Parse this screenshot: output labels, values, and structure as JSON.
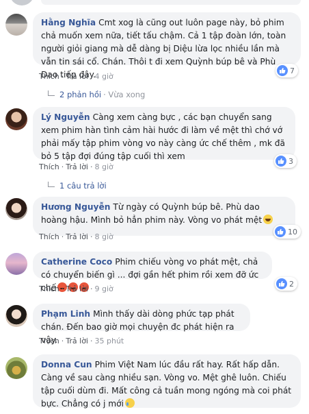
{
  "colors": {
    "author": "#385898",
    "bubble": "#f2f3f5",
    "like": "#5890ff",
    "meta": "#90949c"
  },
  "actions": {
    "like": "Thích",
    "reply": "Trả lời"
  },
  "comments": [
    {
      "author": "Hằng Nghĩa",
      "text": "Cmt xog là cũng out luôn page này, bỏ phim chả muốn xem nữa, tiết tấu chậm. Cả 1 tập đoàn lớn, toàn người giỏi giang mà dễ dàng bị Diệu lừa lọc nhiều lần mà vẫn tin sái cổ. Chán. Thôi t đi xem Quỳnh búp bê và Phù Dao tiếp đây.",
      "time": "4 giờ",
      "reactions": "7",
      "replies": "2 phản hồi",
      "replies_time": "· Vừa xong"
    },
    {
      "author": "Lý Nguyễn",
      "text": "Càng xem càng bực , các bạn chuyển sang xem phim hàn tình cảm hài hước đi làm về mệt thì chớ vớ phải mấy tập phim vòng vo này càng ức chế thêm , mk đã bỏ 5 tập đợi đúng tập cuối thì xem",
      "time": "8 giờ",
      "reactions": "3",
      "replies": "1 câu trả lời"
    },
    {
      "author": "Hương Nguyễn",
      "text": "Từ ngày có Quỳnh búp bê. Phù dao hoàng hậu. Mình bỏ hẳn phim này. Vòng vo phát mệt",
      "time": "8 giờ",
      "reactions": "10"
    },
    {
      "author": "Catherine Coco",
      "text": "Phim chiếu vòng vo phát mệt, chả có chuyển biến gì ... đợi gần hết phim rồi xem đỡ ức chế",
      "time": "9 giờ",
      "reactions": "2"
    },
    {
      "author": "Phạm Linh",
      "text": "Mình thấy dài dòng phức tạp phát chán. Đến bao giờ mọi chuyện đc phát hiện ra vậy.",
      "time": "35 phút"
    },
    {
      "author": "Donna Cun",
      "text": "Phim Việt Nam lúc đầu rất hay. Rất hấp dẫn. Càng về sau càng nhiều sạn. Vòng vo. Mệt ghê luôn. Chiếu tập cuối dùm đi. Mất công cả tuần mong ngóng mà coi phát bực. Chẳng có j mới"
    }
  ]
}
